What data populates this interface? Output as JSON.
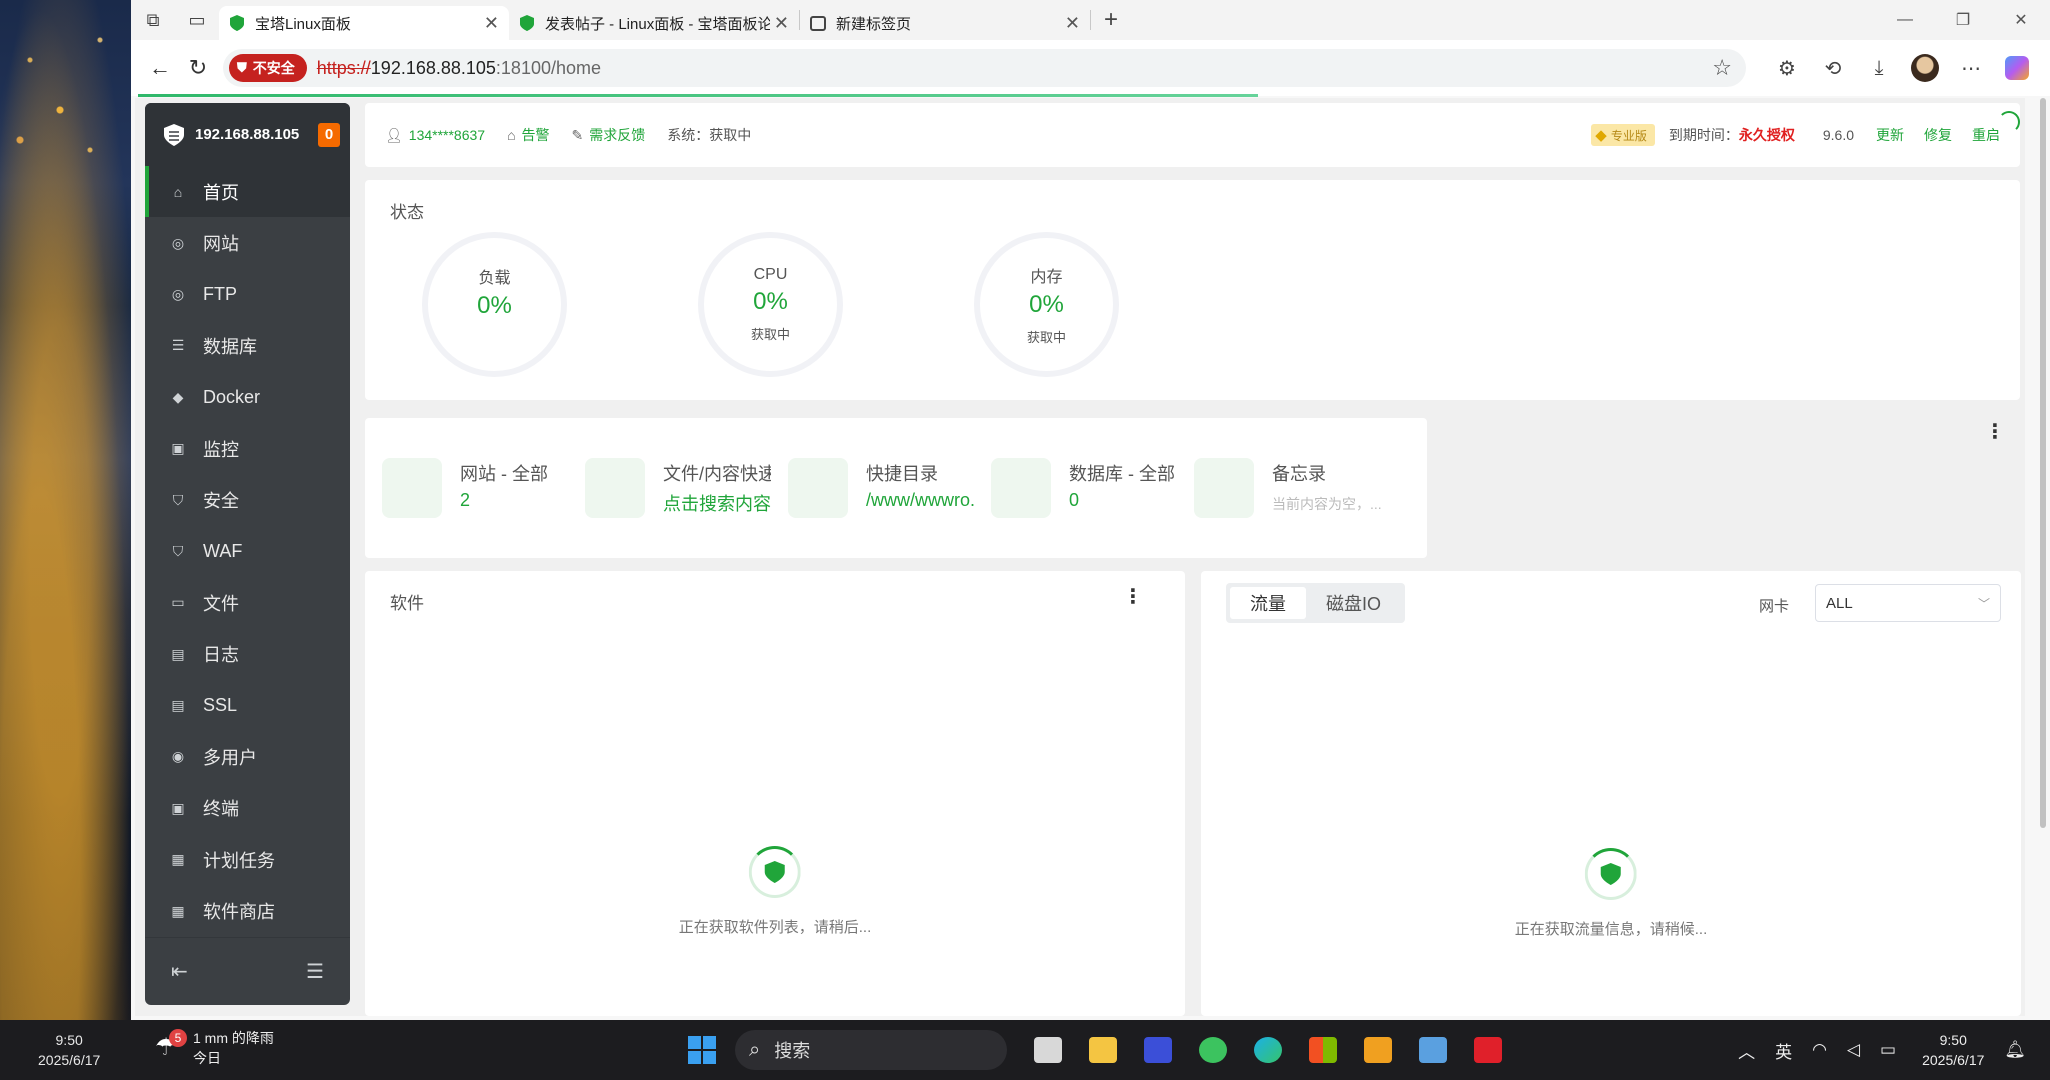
{
  "browser": {
    "tabs": [
      {
        "title": "宝塔Linux面板",
        "active": true
      },
      {
        "title": "发表帖子 - Linux面板 - 宝塔面板论",
        "active": false
      },
      {
        "title": "新建标签页",
        "active": false
      }
    ],
    "security_label": "不安全",
    "url_scheme": "https://",
    "url_host": "192.168.88.105",
    "url_rest": ":18100/home"
  },
  "sidebar": {
    "host": "192.168.88.105",
    "badge": "0",
    "items": [
      {
        "label": "首页",
        "icon": "home-icon",
        "glyph": "⌂"
      },
      {
        "label": "网站",
        "icon": "globe-icon",
        "glyph": "◎"
      },
      {
        "label": "FTP",
        "icon": "ftp-icon",
        "glyph": "◎"
      },
      {
        "label": "数据库",
        "icon": "database-icon",
        "glyph": "☰"
      },
      {
        "label": "Docker",
        "icon": "docker-icon",
        "glyph": "◆"
      },
      {
        "label": "监控",
        "icon": "monitor-icon",
        "glyph": "▣"
      },
      {
        "label": "安全",
        "icon": "shield-icon",
        "glyph": "⛉"
      },
      {
        "label": "WAF",
        "icon": "waf-icon",
        "glyph": "⛉"
      },
      {
        "label": "文件",
        "icon": "folder-icon",
        "glyph": "▭"
      },
      {
        "label": "日志",
        "icon": "log-icon",
        "glyph": "▤"
      },
      {
        "label": "SSL",
        "icon": "ssl-icon",
        "glyph": "▤"
      },
      {
        "label": "多用户",
        "icon": "users-icon",
        "glyph": "◉"
      },
      {
        "label": "终端",
        "icon": "terminal-icon",
        "glyph": "▣"
      },
      {
        "label": "计划任务",
        "icon": "calendar-icon",
        "glyph": "▦"
      },
      {
        "label": "软件商店",
        "icon": "apps-icon",
        "glyph": "▦"
      }
    ]
  },
  "topbar": {
    "user": "134****8637",
    "alarm": "告警",
    "feedback": "需求反馈",
    "system_label": "系统：获取中",
    "pro_label": "专业版",
    "expire_label": "到期时间：",
    "expire_value": "永久授权",
    "version": "9.6.0",
    "update": "更新",
    "repair": "修复",
    "restart": "重启"
  },
  "status": {
    "title": "状态",
    "gauges": [
      {
        "label": "负载",
        "value": "0%",
        "sub": ""
      },
      {
        "label": "CPU",
        "value": "0%",
        "sub": "获取中"
      },
      {
        "label": "内存",
        "value": "0%",
        "sub": "获取中"
      }
    ]
  },
  "cards": [
    {
      "title": "网站 - 全部",
      "value": "2",
      "muted": false
    },
    {
      "title": "文件/内容快速...",
      "value": "点击搜索内容",
      "muted": false
    },
    {
      "title": "快捷目录",
      "value": "/www/wwwro...",
      "muted": false
    },
    {
      "title": "数据库 - 全部",
      "value": "0",
      "muted": false
    },
    {
      "title": "备忘录",
      "value": "当前内容为空，...",
      "muted": true
    }
  ],
  "software": {
    "title": "软件",
    "loading": "正在获取软件列表，请稍后..."
  },
  "traffic": {
    "tabs": [
      "流量",
      "磁盘IO"
    ],
    "nic_label": "网卡",
    "nic_value": "ALL",
    "loading": "正在获取流量信息，请稍候..."
  },
  "taskbar": {
    "time": "9:50",
    "date": "2025/6/17",
    "weather_badge": "5",
    "weather_line1": "1 mm 的降雨",
    "weather_line2": "今日",
    "search_label": "搜索",
    "ime": "英"
  },
  "colors": {
    "accent": "#20a53a",
    "sidebar": "#3b3f43",
    "danger": "#e02020"
  }
}
